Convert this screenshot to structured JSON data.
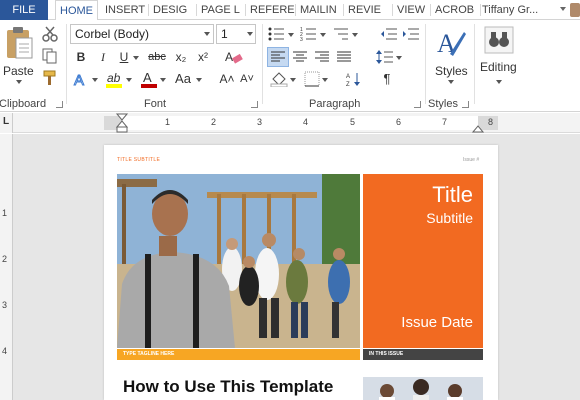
{
  "tabs": {
    "file": "FILE",
    "home": "HOME",
    "insert": "INSERT",
    "design": "DESIG",
    "page_layout": "PAGE L",
    "references": "REFERE",
    "mailings": "MAILIN",
    "review": "REVIE",
    "view": "VIEW",
    "acrobat": "ACROB",
    "user": "Tiffany Gr..."
  },
  "clipboard": {
    "paste": "Paste",
    "group": "Clipboard"
  },
  "font": {
    "name": "Corbel (Body)",
    "size": "1",
    "bold": "B",
    "italic": "I",
    "underline": "U",
    "strike": "abc",
    "subscript": "x₂",
    "superscript": "x²",
    "change_case": "Aa",
    "grow": "A˄",
    "shrink": "A˅",
    "group": "Font"
  },
  "paragraph": {
    "pilcrow": "¶",
    "group": "Paragraph"
  },
  "styles": {
    "label": "Styles",
    "group": "Styles"
  },
  "editing": {
    "label": "Editing"
  },
  "ruler": {
    "numbers": [
      "1",
      "2",
      "3",
      "4",
      "5",
      "6",
      "7",
      "8"
    ],
    "tab_selector": "L"
  },
  "vruler": {
    "numbers": [
      "1",
      "2",
      "3",
      "4"
    ]
  },
  "document": {
    "header_left": "TITLE SUBTITLE",
    "header_right": "Issue #",
    "cover_title": "Title",
    "cover_subtitle": "Subtitle",
    "cover_date": "Issue Date",
    "tagline": "TYPE TAGLINE HERE",
    "in_this_issue": "IN THIS ISSUE",
    "heading": "How to Use This Template"
  },
  "colors": {
    "accent_blue": "#2b579a",
    "orange": "#f26a21",
    "tagline_orange": "#f7a623",
    "dark_bar": "#444444"
  }
}
